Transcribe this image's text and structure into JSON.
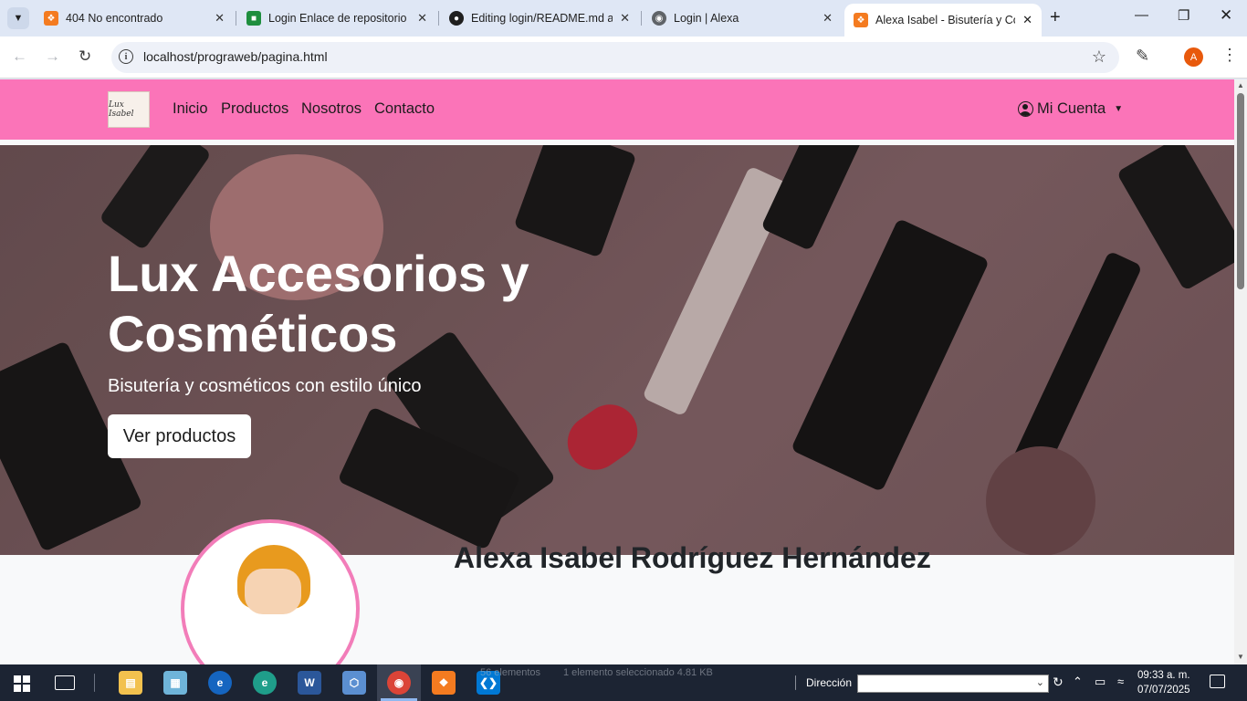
{
  "browser": {
    "tabs": [
      {
        "title": "404 No encontrado",
        "favicon": "xampp-icon"
      },
      {
        "title": "Login Enlace de repositorio de",
        "favicon": "google-classroom-icon"
      },
      {
        "title": "Editing login/README.md at",
        "favicon": "github-icon"
      },
      {
        "title": "Login | Alexa",
        "favicon": "globe-icon"
      },
      {
        "title": "Alexa Isabel - Bisutería y Cos",
        "favicon": "xampp-icon",
        "active": true
      }
    ],
    "url": "localhost/prograweb/pagina.html",
    "profile_initial": "A"
  },
  "site": {
    "nav": {
      "logo_text": "Lux Isabel",
      "links": [
        "Inicio",
        "Productos",
        "Nosotros",
        "Contacto"
      ],
      "account": "Mi Cuenta"
    },
    "hero": {
      "title": "Lux Accesorios y Cosméticos",
      "subtitle": "Bisutería y cosméticos con estilo único",
      "button": "Ver productos"
    },
    "about": {
      "name": "Alexa Isabel Rodríguez Hernández"
    },
    "colors": {
      "navbar": "#fb74b8",
      "profile_border": "#f27db9"
    }
  },
  "taskbar": {
    "explorer_ghost_text": [
      "56 elementos",
      "1 elemento seleccionado  4.81 KB"
    ],
    "address_label": "Dirección",
    "time": "09:33 a. m.",
    "date": "07/07/2025"
  }
}
